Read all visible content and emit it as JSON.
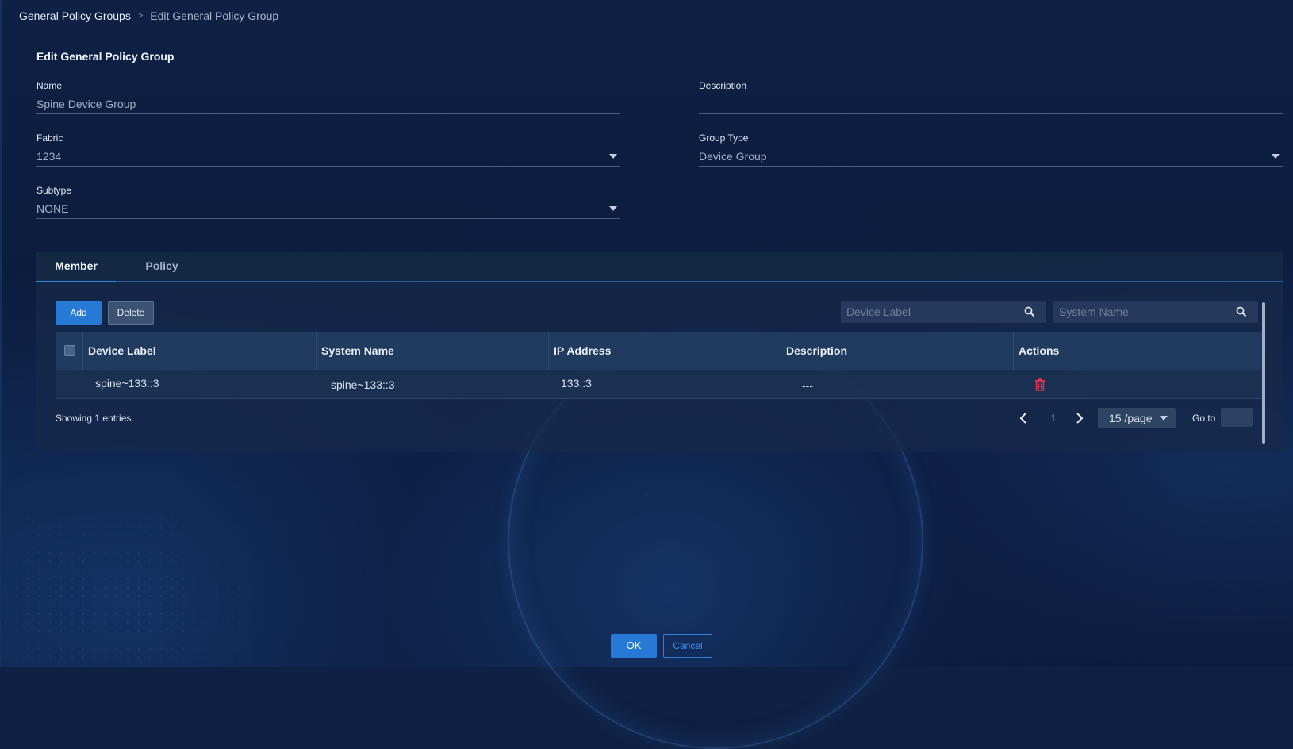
{
  "breadcrumb": {
    "parent": "General Policy Groups",
    "separator": ">",
    "current": "Edit General Policy Group"
  },
  "form": {
    "title": "Edit General Policy Group",
    "name": {
      "label": "Name",
      "value": "Spine Device Group"
    },
    "description": {
      "label": "Description",
      "value": ""
    },
    "fabric": {
      "label": "Fabric",
      "value": "1234"
    },
    "group_type": {
      "label": "Group Type",
      "value": "Device Group"
    },
    "subtype": {
      "label": "Subtype",
      "value": "NONE"
    }
  },
  "tabs": [
    {
      "label": "Member",
      "active": true
    },
    {
      "label": "Policy",
      "active": false
    }
  ],
  "toolbar": {
    "add_label": "Add",
    "delete_label": "Delete",
    "search_device_label_placeholder": "Device Label",
    "search_system_name_placeholder": "System Name"
  },
  "table": {
    "columns": [
      "Device Label",
      "System Name",
      "IP Address",
      "Description",
      "Actions"
    ],
    "rows": [
      {
        "device_label": "spine~133::3",
        "system_name": "spine~133::3",
        "ip_address": "133::3",
        "description": "---",
        "action_icon": "trash-icon"
      }
    ]
  },
  "footer": {
    "showing": "Showing 1 entries.",
    "current_page": "1",
    "page_size": "15 /page",
    "goto_label": "Go to"
  },
  "actions": {
    "ok_label": "OK",
    "cancel_label": "Cancel"
  },
  "colors": {
    "primary": "#2679d4",
    "danger": "#e0314f",
    "background": "#0b1c3c"
  }
}
